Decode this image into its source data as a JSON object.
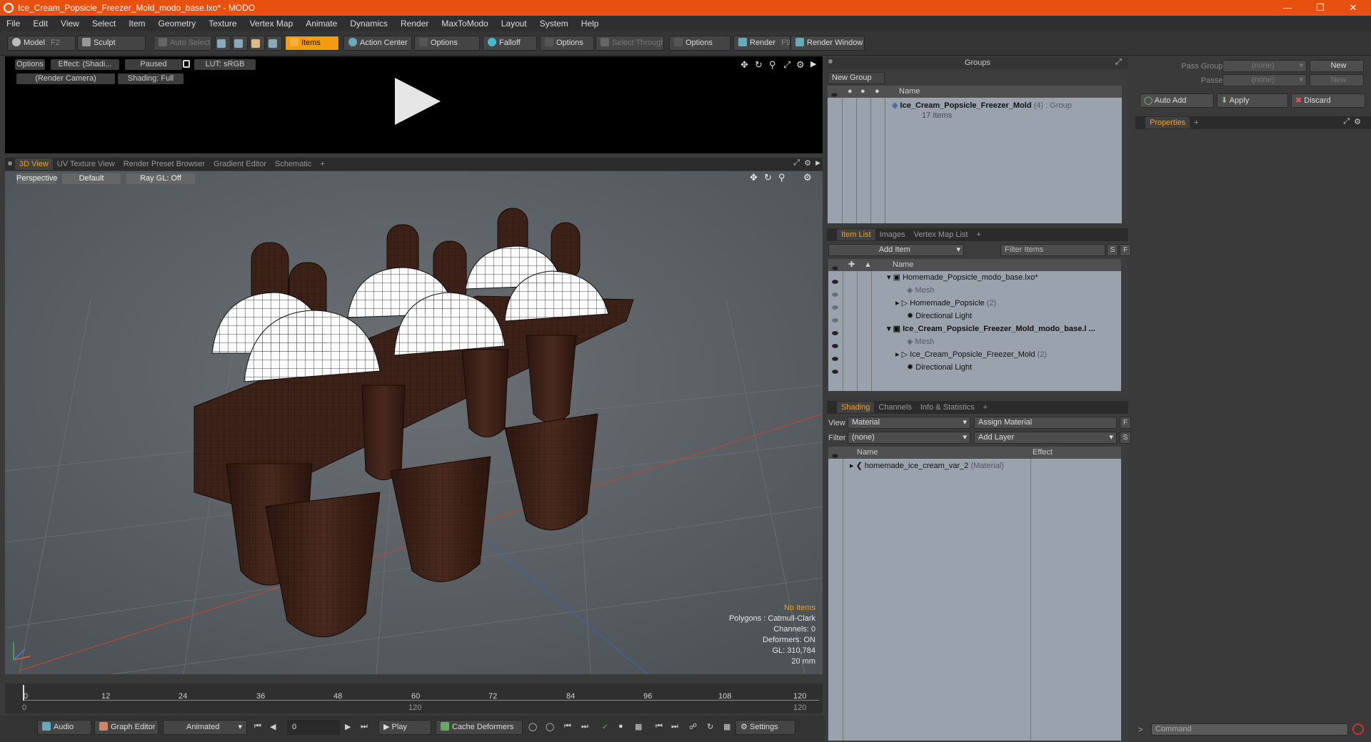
{
  "window": {
    "title": "Ice_Cream_Popsicle_Freezer_Mold_modo_base.lxo* - MODO"
  },
  "menu": [
    "File",
    "Edit",
    "View",
    "Select",
    "Item",
    "Geometry",
    "Texture",
    "Vertex Map",
    "Animate",
    "Dynamics",
    "Render",
    "MaxToModo",
    "Layout",
    "System",
    "Help"
  ],
  "toolbar": {
    "model": "Model",
    "model_key": "F2",
    "sculpt": "Sculpt",
    "auto_select": "Auto Select",
    "items": "Items",
    "action_center": "Action Center",
    "options": "Options",
    "falloff": "Falloff",
    "select_through": "Select Through",
    "render": "Render",
    "render_key": "F9",
    "render_window": "Render Window"
  },
  "preview": {
    "options": "Options",
    "effect": "Effect: (Shadi...",
    "paused": "Paused",
    "lut": "LUT: sRGB",
    "camera": "(Render Camera)",
    "shading": "Shading: Full"
  },
  "view_tabs": [
    "3D View",
    "UV Texture View",
    "Render Preset Browser",
    "Gradient Editor",
    "Schematic",
    "+"
  ],
  "viewport": {
    "perspective": "Perspective",
    "default": "Default",
    "raygl": "Ray GL: Off",
    "info": {
      "items": "No Items",
      "polygons": "Polygons : Catmull-Clark",
      "channels": "Channels: 0",
      "deformers": "Deformers: ON",
      "gl": "GL: 310,784",
      "size": "20 mm"
    }
  },
  "timeline": {
    "ticks": [
      "0",
      "12",
      "24",
      "36",
      "48",
      "60",
      "72",
      "84",
      "96",
      "108",
      "120"
    ],
    "sub": [
      "0",
      "120",
      "120"
    ]
  },
  "bottom": {
    "audio": "Audio",
    "graph_editor": "Graph Editor",
    "animated": "Animated",
    "frame": "0",
    "play": "Play",
    "cache": "Cache Deformers",
    "settings": "Settings"
  },
  "groups": {
    "title": "Groups",
    "new_group": "New Group",
    "col_name": "Name",
    "item_name": "Ice_Cream_Popsicle_Freezer_Mold",
    "item_count": "(4)",
    "item_type": ": Group",
    "item_sub": "17 Items"
  },
  "itemlist": {
    "tabs": [
      "Item List",
      "Images",
      "Vertex Map List",
      "+"
    ],
    "add_item": "Add Item",
    "filter": "Filter Items",
    "s": "S",
    "f": "F",
    "col_name": "Name",
    "rows": [
      {
        "label": "Homemade_Popsicle_modo_base.lxo*",
        "extra": ""
      },
      {
        "label": "Mesh",
        "extra": ""
      },
      {
        "label": "Homemade_Popsicle",
        "extra": "(2)"
      },
      {
        "label": "Directional Light",
        "extra": ""
      },
      {
        "label": "Ice_Cream_Popsicle_Freezer_Mold_modo_base.l ...",
        "extra": ""
      },
      {
        "label": "Mesh",
        "extra": ""
      },
      {
        "label": "Ice_Cream_Popsicle_Freezer_Mold",
        "extra": "(2)"
      },
      {
        "label": "Directional Light",
        "extra": ""
      }
    ]
  },
  "shading": {
    "tabs": [
      "Shading",
      "Channels",
      "Info & Statistics",
      "+"
    ],
    "view_label": "View",
    "view_value": "Material",
    "assign": "Assign Material",
    "filter_label": "Filter",
    "filter_value": "(none)",
    "add_layer": "Add Layer",
    "f": "F",
    "s": "S",
    "col_name": "Name",
    "col_effect": "Effect",
    "row_name": "homemade_ice_cream_var_2",
    "row_type": "(Material)"
  },
  "right": {
    "pass_groups": "Pass Groups",
    "passes": "Passes",
    "none": "(none)",
    "new": "New",
    "auto_add": "Auto Add",
    "apply": "Apply",
    "discard": "Discard",
    "properties": "Properties",
    "plus": "+",
    "command": "Command"
  },
  "colors": {
    "accent": "#f39c12",
    "titlebar": "#e8500f",
    "chocolate": "#3b2118",
    "cream": "#ffffff"
  }
}
